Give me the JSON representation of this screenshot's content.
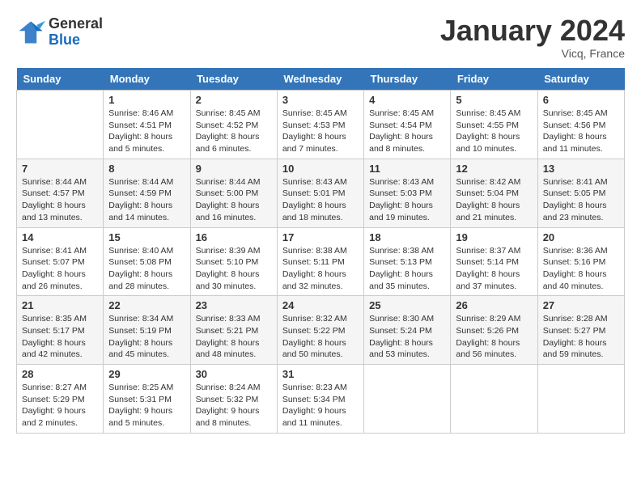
{
  "logo": {
    "text_general": "General",
    "text_blue": "Blue"
  },
  "title": "January 2024",
  "location": "Vicq, France",
  "weekdays": [
    "Sunday",
    "Monday",
    "Tuesday",
    "Wednesday",
    "Thursday",
    "Friday",
    "Saturday"
  ],
  "weeks": [
    [
      {
        "day": "",
        "sunrise": "",
        "sunset": "",
        "daylight": ""
      },
      {
        "day": "1",
        "sunrise": "Sunrise: 8:46 AM",
        "sunset": "Sunset: 4:51 PM",
        "daylight": "Daylight: 8 hours and 5 minutes."
      },
      {
        "day": "2",
        "sunrise": "Sunrise: 8:45 AM",
        "sunset": "Sunset: 4:52 PM",
        "daylight": "Daylight: 8 hours and 6 minutes."
      },
      {
        "day": "3",
        "sunrise": "Sunrise: 8:45 AM",
        "sunset": "Sunset: 4:53 PM",
        "daylight": "Daylight: 8 hours and 7 minutes."
      },
      {
        "day": "4",
        "sunrise": "Sunrise: 8:45 AM",
        "sunset": "Sunset: 4:54 PM",
        "daylight": "Daylight: 8 hours and 8 minutes."
      },
      {
        "day": "5",
        "sunrise": "Sunrise: 8:45 AM",
        "sunset": "Sunset: 4:55 PM",
        "daylight": "Daylight: 8 hours and 10 minutes."
      },
      {
        "day": "6",
        "sunrise": "Sunrise: 8:45 AM",
        "sunset": "Sunset: 4:56 PM",
        "daylight": "Daylight: 8 hours and 11 minutes."
      }
    ],
    [
      {
        "day": "7",
        "sunrise": "Sunrise: 8:44 AM",
        "sunset": "Sunset: 4:57 PM",
        "daylight": "Daylight: 8 hours and 13 minutes."
      },
      {
        "day": "8",
        "sunrise": "Sunrise: 8:44 AM",
        "sunset": "Sunset: 4:59 PM",
        "daylight": "Daylight: 8 hours and 14 minutes."
      },
      {
        "day": "9",
        "sunrise": "Sunrise: 8:44 AM",
        "sunset": "Sunset: 5:00 PM",
        "daylight": "Daylight: 8 hours and 16 minutes."
      },
      {
        "day": "10",
        "sunrise": "Sunrise: 8:43 AM",
        "sunset": "Sunset: 5:01 PM",
        "daylight": "Daylight: 8 hours and 18 minutes."
      },
      {
        "day": "11",
        "sunrise": "Sunrise: 8:43 AM",
        "sunset": "Sunset: 5:03 PM",
        "daylight": "Daylight: 8 hours and 19 minutes."
      },
      {
        "day": "12",
        "sunrise": "Sunrise: 8:42 AM",
        "sunset": "Sunset: 5:04 PM",
        "daylight": "Daylight: 8 hours and 21 minutes."
      },
      {
        "day": "13",
        "sunrise": "Sunrise: 8:41 AM",
        "sunset": "Sunset: 5:05 PM",
        "daylight": "Daylight: 8 hours and 23 minutes."
      }
    ],
    [
      {
        "day": "14",
        "sunrise": "Sunrise: 8:41 AM",
        "sunset": "Sunset: 5:07 PM",
        "daylight": "Daylight: 8 hours and 26 minutes."
      },
      {
        "day": "15",
        "sunrise": "Sunrise: 8:40 AM",
        "sunset": "Sunset: 5:08 PM",
        "daylight": "Daylight: 8 hours and 28 minutes."
      },
      {
        "day": "16",
        "sunrise": "Sunrise: 8:39 AM",
        "sunset": "Sunset: 5:10 PM",
        "daylight": "Daylight: 8 hours and 30 minutes."
      },
      {
        "day": "17",
        "sunrise": "Sunrise: 8:38 AM",
        "sunset": "Sunset: 5:11 PM",
        "daylight": "Daylight: 8 hours and 32 minutes."
      },
      {
        "day": "18",
        "sunrise": "Sunrise: 8:38 AM",
        "sunset": "Sunset: 5:13 PM",
        "daylight": "Daylight: 8 hours and 35 minutes."
      },
      {
        "day": "19",
        "sunrise": "Sunrise: 8:37 AM",
        "sunset": "Sunset: 5:14 PM",
        "daylight": "Daylight: 8 hours and 37 minutes."
      },
      {
        "day": "20",
        "sunrise": "Sunrise: 8:36 AM",
        "sunset": "Sunset: 5:16 PM",
        "daylight": "Daylight: 8 hours and 40 minutes."
      }
    ],
    [
      {
        "day": "21",
        "sunrise": "Sunrise: 8:35 AM",
        "sunset": "Sunset: 5:17 PM",
        "daylight": "Daylight: 8 hours and 42 minutes."
      },
      {
        "day": "22",
        "sunrise": "Sunrise: 8:34 AM",
        "sunset": "Sunset: 5:19 PM",
        "daylight": "Daylight: 8 hours and 45 minutes."
      },
      {
        "day": "23",
        "sunrise": "Sunrise: 8:33 AM",
        "sunset": "Sunset: 5:21 PM",
        "daylight": "Daylight: 8 hours and 48 minutes."
      },
      {
        "day": "24",
        "sunrise": "Sunrise: 8:32 AM",
        "sunset": "Sunset: 5:22 PM",
        "daylight": "Daylight: 8 hours and 50 minutes."
      },
      {
        "day": "25",
        "sunrise": "Sunrise: 8:30 AM",
        "sunset": "Sunset: 5:24 PM",
        "daylight": "Daylight: 8 hours and 53 minutes."
      },
      {
        "day": "26",
        "sunrise": "Sunrise: 8:29 AM",
        "sunset": "Sunset: 5:26 PM",
        "daylight": "Daylight: 8 hours and 56 minutes."
      },
      {
        "day": "27",
        "sunrise": "Sunrise: 8:28 AM",
        "sunset": "Sunset: 5:27 PM",
        "daylight": "Daylight: 8 hours and 59 minutes."
      }
    ],
    [
      {
        "day": "28",
        "sunrise": "Sunrise: 8:27 AM",
        "sunset": "Sunset: 5:29 PM",
        "daylight": "Daylight: 9 hours and 2 minutes."
      },
      {
        "day": "29",
        "sunrise": "Sunrise: 8:25 AM",
        "sunset": "Sunset: 5:31 PM",
        "daylight": "Daylight: 9 hours and 5 minutes."
      },
      {
        "day": "30",
        "sunrise": "Sunrise: 8:24 AM",
        "sunset": "Sunset: 5:32 PM",
        "daylight": "Daylight: 9 hours and 8 minutes."
      },
      {
        "day": "31",
        "sunrise": "Sunrise: 8:23 AM",
        "sunset": "Sunset: 5:34 PM",
        "daylight": "Daylight: 9 hours and 11 minutes."
      },
      {
        "day": "",
        "sunrise": "",
        "sunset": "",
        "daylight": ""
      },
      {
        "day": "",
        "sunrise": "",
        "sunset": "",
        "daylight": ""
      },
      {
        "day": "",
        "sunrise": "",
        "sunset": "",
        "daylight": ""
      }
    ]
  ]
}
